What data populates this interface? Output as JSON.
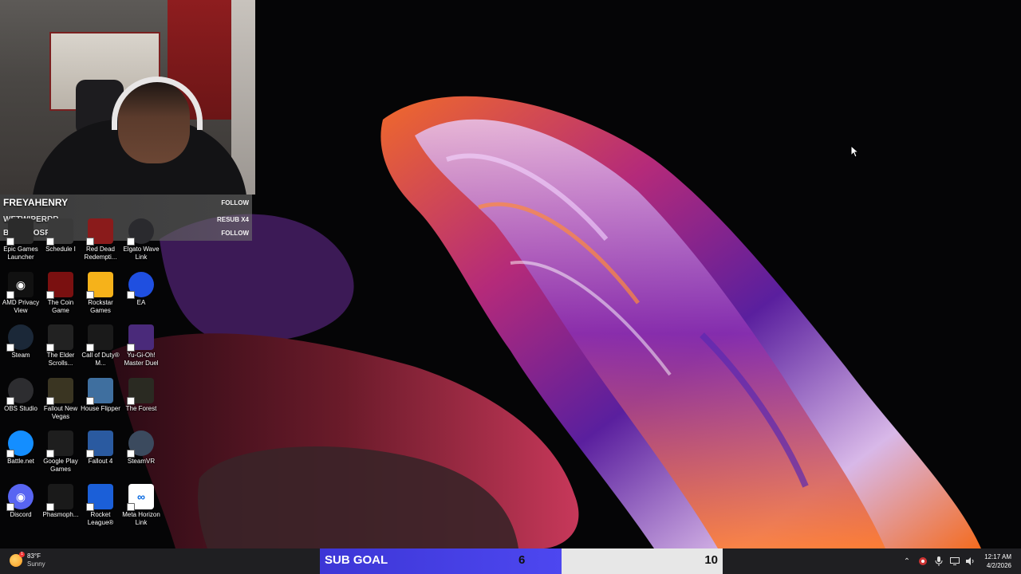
{
  "stream_events": [
    {
      "name": "FREYAHENRY",
      "action": "FOLLOW"
    },
    {
      "name": "WETWIPERRR",
      "action": "RESUB X4"
    },
    {
      "name": "BRAULIOSPEAKS",
      "action": "FOLLOW"
    }
  ],
  "desktop_icons": [
    {
      "label": "Epic Games Launcher",
      "icon": "epic-games-icon",
      "color": "#2b2b2b"
    },
    {
      "label": "Schedule I",
      "icon": "schedule-one-icon",
      "color": "#3a3a3a"
    },
    {
      "label": "Red Dead Redempti...",
      "icon": "red-dead-icon",
      "color": "#8a1b1b"
    },
    {
      "label": "Elgato Wave Link",
      "icon": "wave-link-icon",
      "color": "#2a2a2e"
    },
    {
      "label": "AMD Privacy View",
      "icon": "eye-icon",
      "color": "#111111"
    },
    {
      "label": "The Coin Game",
      "icon": "coin-game-icon",
      "color": "#7a1010"
    },
    {
      "label": "Rockstar Games",
      "icon": "rockstar-icon",
      "color": "#f6b21a"
    },
    {
      "label": "EA",
      "icon": "ea-icon",
      "color": "#1f4fe0"
    },
    {
      "label": "Steam",
      "icon": "steam-icon",
      "color": "#1b2838"
    },
    {
      "label": "The Elder Scrolls...",
      "icon": "elder-scrolls-icon",
      "color": "#222222"
    },
    {
      "label": "Call of Duty® M...",
      "icon": "call-of-duty-icon",
      "color": "#1a1a1a"
    },
    {
      "label": "Yu-Gi-Oh! Master Duel",
      "icon": "yugioh-icon",
      "color": "#4a2a7a"
    },
    {
      "label": "OBS Studio",
      "icon": "obs-icon",
      "color": "#2d2d30"
    },
    {
      "label": "Fallout New Vegas",
      "icon": "fallout-nv-icon",
      "color": "#3a3522"
    },
    {
      "label": "House Flipper",
      "icon": "house-flipper-icon",
      "color": "#3f6f9f"
    },
    {
      "label": "The Forest",
      "icon": "the-forest-icon",
      "color": "#2a2a22"
    },
    {
      "label": "Battle.net",
      "icon": "battlenet-icon",
      "color": "#148eff"
    },
    {
      "label": "Google Play Games",
      "icon": "google-play-games-icon",
      "color": "#1e1e1e"
    },
    {
      "label": "Fallout 4",
      "icon": "fallout4-icon",
      "color": "#2a5aa0"
    },
    {
      "label": "SteamVR",
      "icon": "steamvr-icon",
      "color": "#3b4a5e"
    },
    {
      "label": "Discord",
      "icon": "discord-icon",
      "color": "#5865f2"
    },
    {
      "label": "Phasmoph...",
      "icon": "phasmophobia-icon",
      "color": "#1a1a1a"
    },
    {
      "label": "Rocket League®",
      "icon": "rocket-league-icon",
      "color": "#1b5fd8"
    },
    {
      "label": "Meta Horizon Link",
      "icon": "meta-icon",
      "color": "#ffffff"
    }
  ],
  "taskbar": {
    "weather_temp": "83°F",
    "weather_desc": "Sunny",
    "weather_badge": "1",
    "sub_goal_label": "SUB GOAL",
    "sub_goal_current": "6",
    "sub_goal_target": "10",
    "sub_goal_progress": 0.6,
    "time": "12:17 AM",
    "date": "4/2/2026"
  }
}
